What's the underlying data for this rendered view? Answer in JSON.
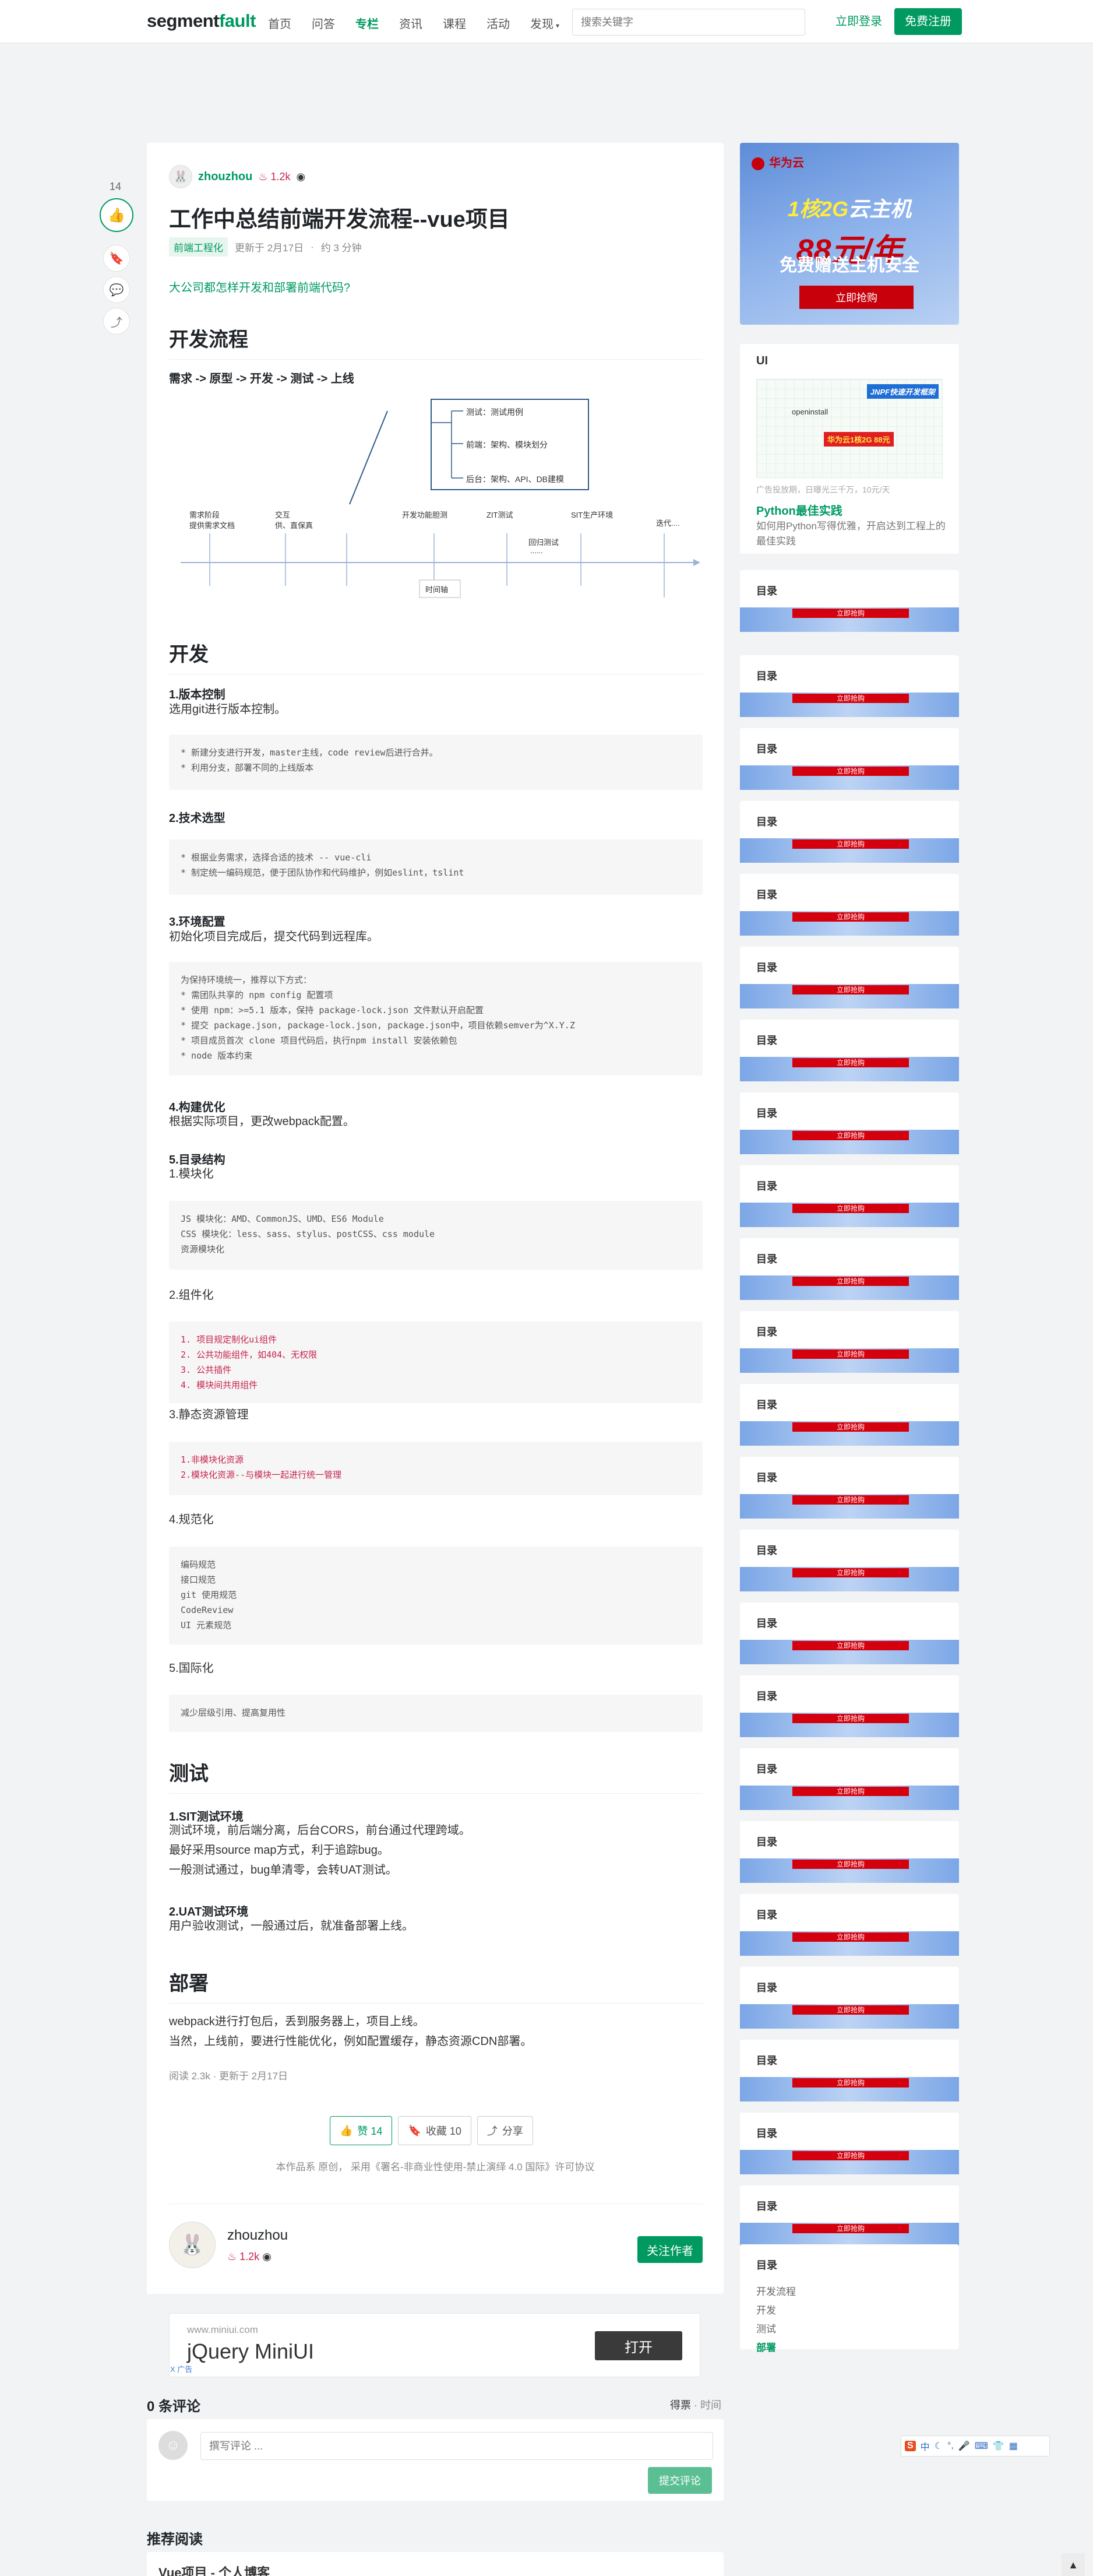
{
  "nav": {
    "logo_main": "segment",
    "logo_hl": "fault",
    "items": [
      "首页",
      "问答",
      "专栏",
      "资讯",
      "课程",
      "活动",
      "发现"
    ],
    "active_item": "专栏",
    "search_placeholder": "搜索关键字",
    "login_label": "立即登录",
    "register_label": "免费注册"
  },
  "side_actions": {
    "like_count": "14"
  },
  "article": {
    "author": "zhouzhou",
    "reputation": "1.2k",
    "title": "工作中总结前端开发流程--vue项目",
    "tag": "前端工程化",
    "updated": "更新于 2月17日",
    "read_time": "约 3 分钟",
    "intro_link": "大公司都怎样开发和部署前端代码?",
    "sections": {
      "flow": {
        "heading": "开发流程",
        "flow_line": "需求 -> 原型 -> 开发 -> 测试 -> 上线",
        "diagram": {
          "box_lines": [
            "测试：测试用例",
            "前端：架构、模块划分",
            "后台：架构、API、DB建模"
          ],
          "stages": [
            "需求阶段",
            "提供需求文档",
            "交互",
            "供、直保真",
            "开发功能胆测",
            "ZIT测试",
            "SIT生产环境",
            "迭代....",
            "回归测试",
            "......"
          ],
          "time_label": "时间轴"
        }
      },
      "dev": {
        "heading": "开发",
        "s1_title": "1.版本控制",
        "s1_text": "选用git进行版本控制。",
        "s1_code": [
          "* 新建分支进行开发，master主线，code review后进行合并。",
          "* 利用分支，部署不同的上线版本"
        ],
        "s2_title": "2.技术选型",
        "s2_code": [
          "* 根据业务需求，选择合适的技术 -- vue-cli",
          "* 制定统一编码规范，便于团队协作和代码维护，例如eslint，tslint"
        ],
        "s3_title": "3.环境配置",
        "s3_text": "初始化项目完成后，提交代码到远程库。",
        "s3_code": [
          "为保持环境统一，推荐以下方式：",
          "* 需团队共享的 npm config 配置项",
          "* 使用 npm：>=5.1 版本，保持 package-lock.json 文件默认开启配置",
          "* 提交 package.json, package-lock.json, package.json中，项目依赖semver为^X.Y.Z",
          "* 项目成员首次 clone 项目代码后，执行npm install 安装依赖包",
          "* node 版本约束"
        ],
        "s4_title": "4.构建优化",
        "s4_text": "根据实际项目，更改webpack配置。",
        "s5_title": "5.目录结构",
        "s5_sub1": "1.模块化",
        "s5_code1": [
          "JS 模块化：AMD、CommonJS、UMD、ES6 Module",
          "CSS 模块化：less、sass、stylus、postCSS、css module",
          "资源模块化"
        ],
        "s5_sub2": "2.组件化",
        "s5_code2": [
          "1. 项目规定制化ui组件",
          "2. 公共功能组件，如404、无权限",
          "3. 公共插件",
          "4. 模块间共用组件"
        ],
        "s5_sub3": "3.静态资源管理",
        "s5_code3": [
          "1.非模块化资源",
          "2.模块化资源--与模块一起进行统一管理"
        ],
        "s5_sub4": "4.规范化",
        "s5_code4": [
          "编码规范",
          "接口规范",
          "git 使用规范",
          "CodeReview",
          "UI 元素规范"
        ],
        "s5_sub5": "5.国际化",
        "s5_code5": [
          "减少层级引用、提高复用性"
        ]
      },
      "test": {
        "heading": "测试",
        "s1_title": "1.SIT测试环境",
        "s1_lines": [
          "测试环境，前后端分离，后台CORS，前台通过代理跨域。",
          "最好采用source map方式，利于追踪bug。",
          "一般测试通过，bug单清零，会转UAT测试。"
        ],
        "s2_title": "2.UAT测试环境",
        "s2_text": "用户验收测试，一般通过后，就准备部署上线。"
      },
      "deploy": {
        "heading": "部署",
        "lines": [
          "webpack进行打包后，丢到服务器上，项目上线。",
          "当然，上线前，要进行性能优化，例如配置缓存，静态资源CDN部署。"
        ]
      }
    },
    "stats": "阅读 2.3k · 更新于 2月17日",
    "like_btn": "赞 14",
    "fav_btn": "收藏 10",
    "share_btn": "分享",
    "license": "本作品系 原创， 采用《署名-非商业性使用-禁止演绎 4.0 国际》许可协议",
    "follow_label": "关注作者"
  },
  "sidebar": {
    "ad_brand": "华为云",
    "ad_line1a": "1核2G",
    "ad_line1b": "云主机",
    "ad_line2": "88元/年",
    "ad_line3": "免费赠送主机安全",
    "ad_btn": "立即抢购",
    "ui_card": {
      "title": "UI",
      "badge1": "JNPF快速开发框架",
      "badge2": "华为云1核2G 88元",
      "badge3": "openinstall",
      "caption": "广告投放期，日曝光三千万，10元/天",
      "link": "Python最佳实践",
      "desc": "如何用Python写得优雅，开启达到工程上的最佳实践"
    },
    "toc_label": "目录",
    "toc_btn": "立即抢购",
    "toc_items": [
      "开发流程",
      "开发",
      "测试",
      "部署"
    ],
    "toc_active": "部署"
  },
  "ad2": {
    "url": "www.miniui.com",
    "name": "jQuery MiniUI",
    "open": "打开",
    "mark": "X 广告"
  },
  "comments": {
    "heading": "0 条评论",
    "sort_a": "得票",
    "sort_b": "时间",
    "placeholder": "撰写评论 ...",
    "submit": "提交评论"
  },
  "recommend": {
    "heading": "推荐阅读",
    "first": "Vue项目 - 个人博客"
  },
  "colors": {
    "brand": "#009a61",
    "reputation": "#c7254e",
    "huawei_red": "#c7000b"
  }
}
